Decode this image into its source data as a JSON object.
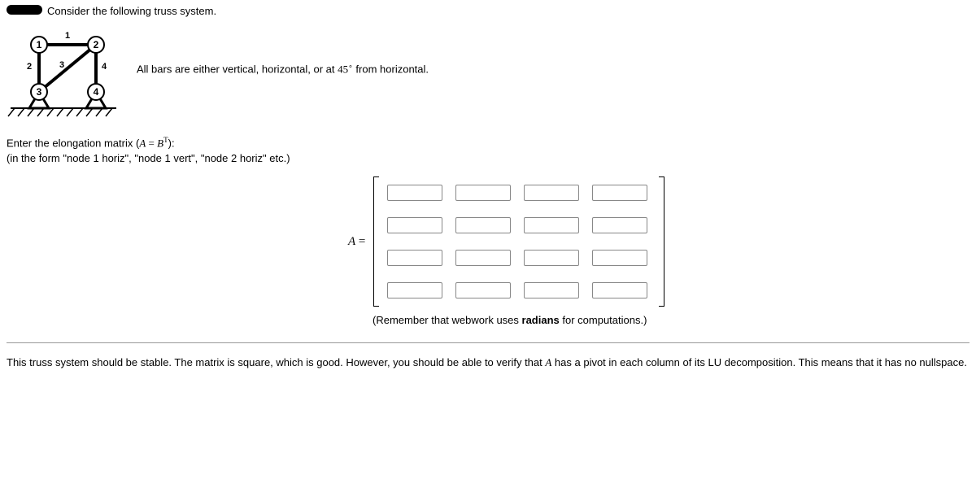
{
  "header": {
    "intro": "Consider the following truss system."
  },
  "angle_line": {
    "prefix": "All bars are either vertical, horizontal, or at ",
    "angle": "45",
    "deg": "∘",
    "suffix": " from horizontal."
  },
  "prompt": {
    "line1_pre": "Enter the elongation matrix (",
    "A": "A",
    "eq": " = ",
    "B": "B",
    "T": "T",
    "line1_post": "):",
    "line2": "(in the form \"node 1 horiz\", \"node 1 vert\", \"node 2 horiz\" etc.)"
  },
  "matrix": {
    "label_A": "A",
    "label_eq": " =",
    "rows": 4,
    "cols": 4
  },
  "reminder": {
    "pre": "(Remember that webwork uses ",
    "bold": "radians",
    "post": " for computations.)"
  },
  "bottom": {
    "pre": "This truss system should be stable. The matrix is square, which is good. However, you should be able to verify that ",
    "A": "A",
    "post": " has a pivot in each column of its LU decomposition. This means that it has no nullspace."
  },
  "diagram": {
    "nodes": [
      "1",
      "2",
      "3",
      "4"
    ],
    "bars": [
      "1",
      "2",
      "3",
      "4"
    ]
  }
}
